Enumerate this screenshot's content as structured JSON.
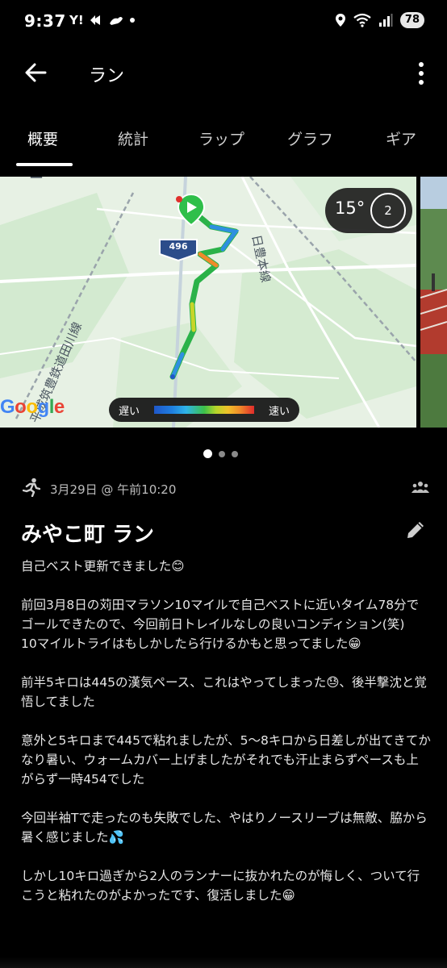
{
  "status_bar": {
    "time": "9:37",
    "notif_text": "Y!",
    "battery": "78",
    "icons": [
      "location-icon",
      "wifi-icon",
      "signal-icon"
    ]
  },
  "app_bar": {
    "title": "ラン",
    "back_icon": "arrow-left-icon",
    "menu_icon": "more-vertical-icon"
  },
  "tabs": [
    {
      "label": "概要",
      "active": true
    },
    {
      "label": "統計",
      "active": false
    },
    {
      "label": "ラップ",
      "active": false
    },
    {
      "label": "グラフ",
      "active": false
    },
    {
      "label": "ギア",
      "active": false
    }
  ],
  "map": {
    "road_label": "日豊本線",
    "rail_label": "平成筑豊鉄道田川線",
    "route_number": "496",
    "top_label": "ー",
    "google": "Google",
    "weather": {
      "temperature": "15°",
      "wind": "2"
    },
    "legend": {
      "slow": "遅い",
      "fast": "速い"
    }
  },
  "carousel": {
    "count": 3,
    "active_index": 0
  },
  "activity": {
    "date": "3月29日 @ 午前10:20",
    "title": "みやこ町 ラン",
    "description": [
      "自己ベスト更新できました😊",
      "前回3月8日の苅田マラソン10マイルで自己ベストに近いタイム78分でゴールできたので、今回前日トレイルなしの良いコンディション(笑)\n10マイルトライはもしかしたら行けるかもと思ってました😁",
      "前半5キロは445の漢気ペース、これはやってしまった😓、後半撃沈と覚悟してました",
      "意外と5キロまで445で粘れましたが、5〜8キロから日差しが出てきてかなり暑い、ウォームカバー上げましたがそれでも汗止まらずペースも上がらず一時454でした",
      "今回半袖Tで走ったのも失敗でした、やはりノースリーブは無敵、脇から暑く感じました💦",
      "しかし10キロ過ぎから2人のランナーに抜かれたのが悔しく、ついて行こうと粘れたのがよかったです、復活しました😁"
    ]
  },
  "colors": {
    "background": "#000000",
    "route_slow": "#1f57c9",
    "route_mid": "#3cc04a",
    "route_fast": "#e02b2b",
    "start_marker": "#2fbf4a"
  }
}
